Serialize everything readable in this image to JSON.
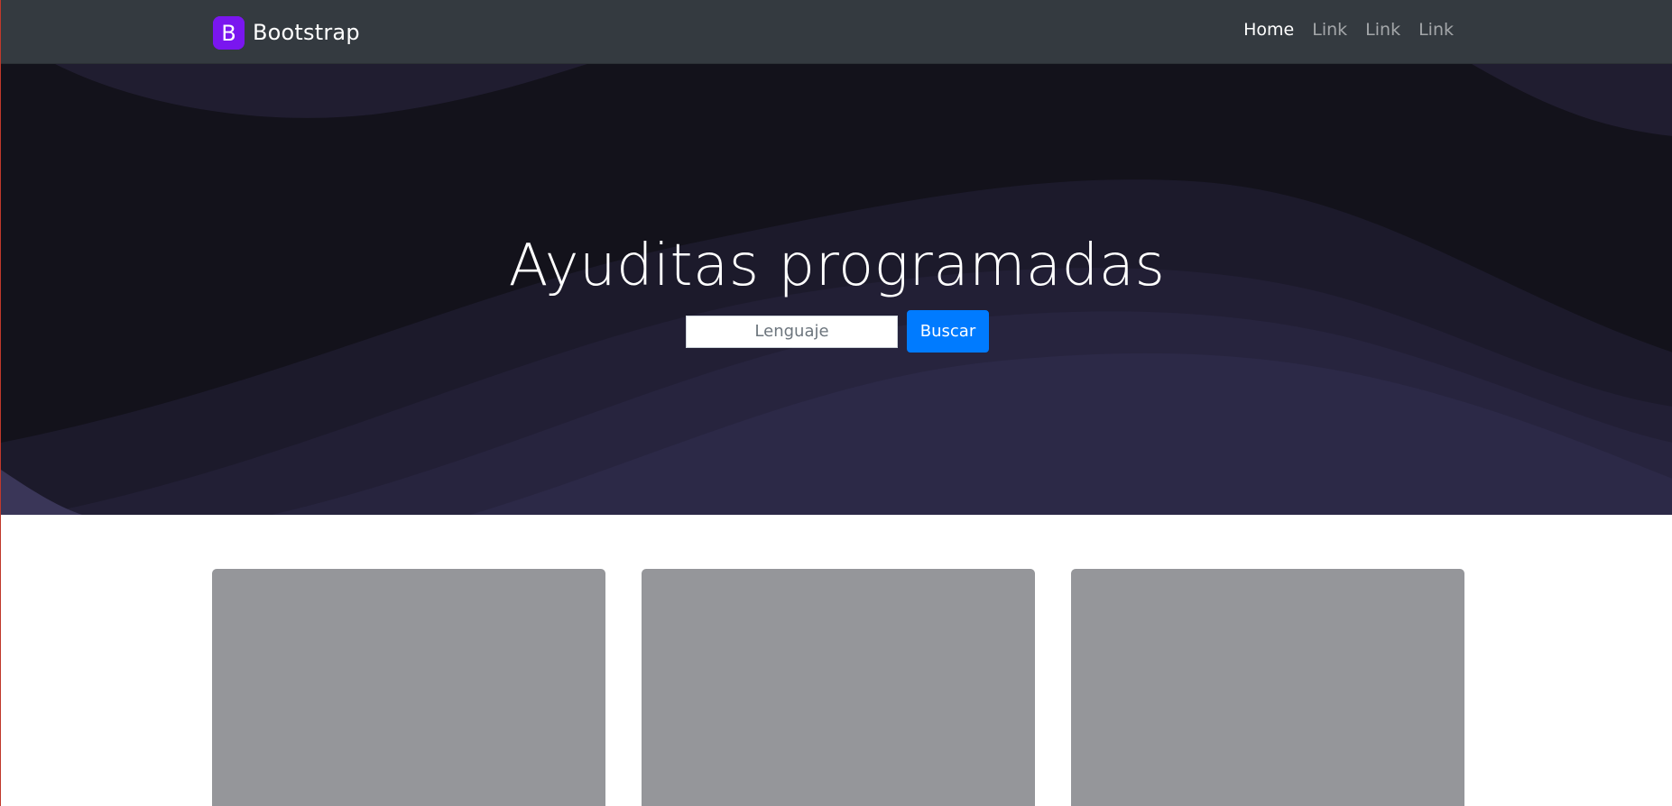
{
  "navbar": {
    "brand": {
      "logo_letter": "B",
      "text": "Bootstrap",
      "logo_color": "#7a16ef"
    },
    "links": [
      {
        "label": "Home",
        "active": true
      },
      {
        "label": "Link",
        "active": false
      },
      {
        "label": "Link",
        "active": false
      },
      {
        "label": "Link",
        "active": false
      }
    ],
    "background": "#343a40"
  },
  "hero": {
    "title": "Ayuditas programadas",
    "search": {
      "placeholder": "Lenguaje",
      "value": ""
    },
    "button_label": "Buscar",
    "button_color": "#007bff"
  },
  "cards": [
    {
      "placeholder_color": "#95969a"
    },
    {
      "placeholder_color": "#95969a"
    },
    {
      "placeholder_color": "#95969a"
    }
  ]
}
